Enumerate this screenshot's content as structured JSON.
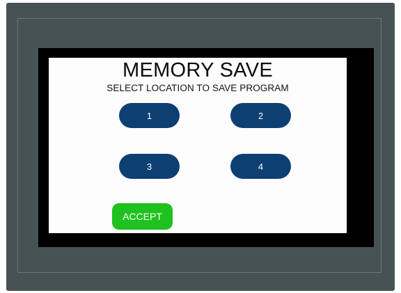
{
  "screen": {
    "title": "MEMORY SAVE",
    "subtitle": "SELECT LOCATION TO SAVE PROGRAM"
  },
  "locations": [
    {
      "label": "1"
    },
    {
      "label": "2"
    },
    {
      "label": "3"
    },
    {
      "label": "4"
    }
  ],
  "accept_label": "ACCEPT",
  "colors": {
    "bezel": "#475254",
    "screen_background": "#fdfdfd",
    "location_button": "#0d3f73",
    "accept_button": "#1fc11f"
  }
}
